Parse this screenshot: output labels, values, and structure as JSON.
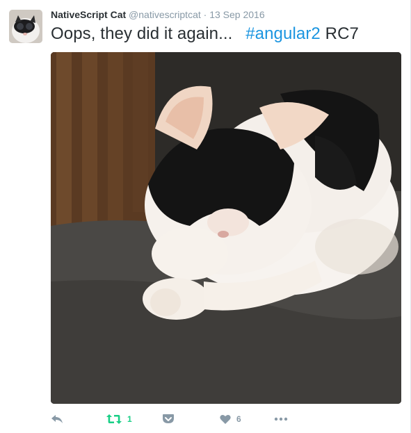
{
  "tweet": {
    "author_name": "NativeScript Cat",
    "handle": "@nativescriptcat",
    "separator": "·",
    "date": "13 Sep 2016",
    "text_before": "Oops, they did it again...",
    "hashtag": "#angular2",
    "text_after": "RC7",
    "retweet_count": "1",
    "like_count": "6"
  },
  "icons": {
    "reply": "reply-icon",
    "retweet": "retweet-icon",
    "save": "pocket-icon",
    "like": "heart-icon",
    "more": "more-dots-icon"
  },
  "colors": {
    "text": "#292f33",
    "muted": "#8899a6",
    "link": "#1b95e0",
    "retweet": "#19cf86"
  }
}
